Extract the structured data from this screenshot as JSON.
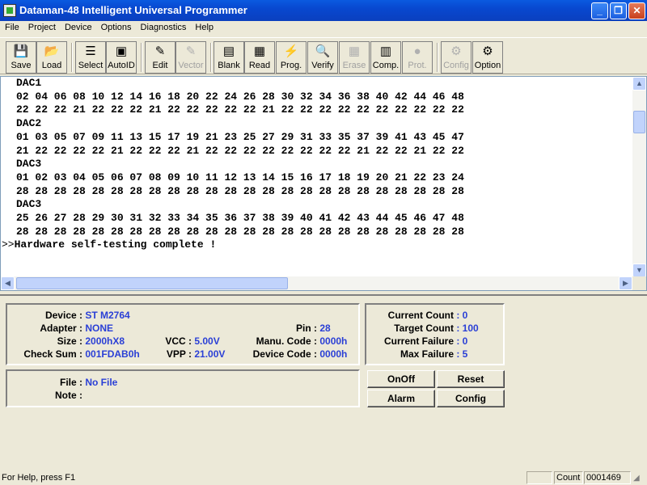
{
  "window": {
    "title": "Dataman-48 Intelligent Universal Programmer"
  },
  "menu": [
    "File",
    "Project",
    "Device",
    "Options",
    "Diagnostics",
    "Help"
  ],
  "toolbar": {
    "save": "Save",
    "load": "Load",
    "select": "Select",
    "autoid": "AutoID",
    "edit": "Edit",
    "vector": "Vector",
    "blank": "Blank",
    "read": "Read",
    "prog": "Prog.",
    "verify": "Verify",
    "erase": "Erase",
    "comp": "Comp.",
    "prot": "Prot.",
    "config": "Config",
    "option": "Option"
  },
  "log": {
    "lines": [
      "DAC1",
      "02 04 06 08 10 12 14 16 18 20 22 24 26 28 30 32 34 36 38 40 42 44 46 48",
      "22 22 22 21 22 22 22 21 22 22 22 22 22 21 22 22 22 22 22 22 22 22 22 22",
      "DAC2",
      "01 03 05 07 09 11 13 15 17 19 21 23 25 27 29 31 33 35 37 39 41 43 45 47",
      "21 22 22 22 22 21 22 22 22 21 22 22 22 22 22 22 22 22 21 22 22 21 22 22",
      "DAC3",
      "01 02 03 04 05 06 07 08 09 10 11 12 13 14 15 16 17 18 19 20 21 22 23 24",
      "28 28 28 28 28 28 28 28 28 28 28 28 28 28 28 28 28 28 28 28 28 28 28 28",
      "DAC3",
      "25 26 27 28 29 30 31 32 33 34 35 36 37 38 39 40 41 42 43 44 45 46 47 48",
      "28 28 28 28 28 28 28 28 28 28 28 28 28 28 28 28 28 28 28 28 28 28 28 28"
    ],
    "prompt": ">>",
    "message": "Hardware self-testing complete !"
  },
  "device_info": {
    "device_label": "Device :",
    "device": "ST M2764",
    "adapter_label": "Adapter :",
    "adapter": "NONE",
    "pin_label": "Pin :",
    "pin": "28",
    "size_label": "Size :",
    "size": "2000hX8",
    "vcc_label": "VCC :",
    "vcc": "5.00V",
    "manu_label": "Manu. Code :",
    "manu": "0000h",
    "checksum_label": "Check Sum :",
    "checksum": "001FDAB0h",
    "vpp_label": "VPP :",
    "vpp": "21.00V",
    "devcode_label": "Device Code :",
    "devcode": "0000h"
  },
  "counters": {
    "current_count_label": "Current Count",
    "current_count": ": 0",
    "target_count_label": "Target Count",
    "target_count": ": 100",
    "current_failure_label": "Current Failure",
    "current_failure": ": 0",
    "max_failure_label": "Max Failure",
    "max_failure": ": 5"
  },
  "file_info": {
    "file_label": "File :",
    "file": "No File",
    "note_label": "Note :",
    "note": ""
  },
  "buttons": {
    "onoff": "OnOff",
    "reset": "Reset",
    "alarm": "Alarm",
    "config": "Config"
  },
  "status": {
    "help": "For Help, press F1",
    "count_label": "Count",
    "count": "0001469"
  }
}
